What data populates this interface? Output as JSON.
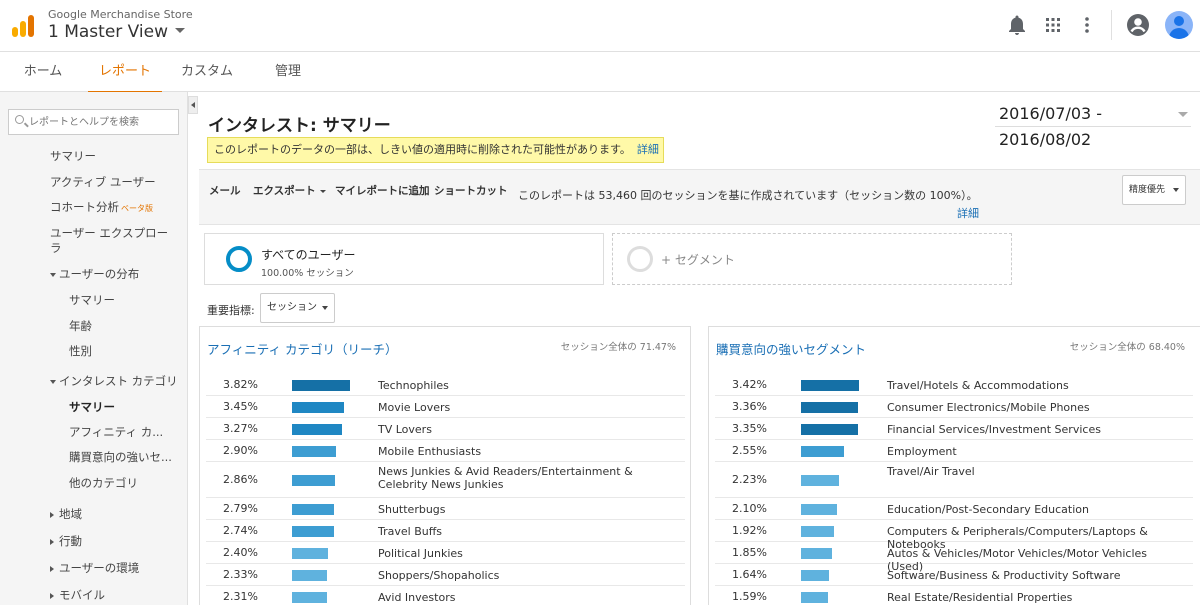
{
  "header": {
    "account": "Google Merchandise Store",
    "view": "1 Master View"
  },
  "nav": {
    "tabs": [
      "ホーム",
      "レポート",
      "カスタム",
      "管理"
    ],
    "active": "レポート"
  },
  "sidebar": {
    "search_placeholder": "レポートとヘルプを検索",
    "items": {
      "summary": "サマリー",
      "active_users": "アクティブ ユーザー",
      "cohort": "コホート分析",
      "cohort_beta": "ベータ版",
      "user_explorer": "ユーザー エクスプローラ",
      "demographics": "ユーザーの分布",
      "demo_summary": "サマリー",
      "age": "年齢",
      "gender": "性別",
      "interests": "インタレスト カテゴリ",
      "int_summary": "サマリー",
      "affinity": "アフィニティ カ...",
      "in_market": "購買意向の強いセ...",
      "other": "他のカテゴリ",
      "geo": "地域",
      "behavior": "行動",
      "technology": "ユーザーの環境",
      "mobile": "モバイル"
    }
  },
  "main": {
    "title": "インタレスト: サマリー",
    "date_range": "2016/07/03 - 2016/08/02",
    "warning": "このレポートのデータの一部は、しきい値の適用時に削除された可能性があります。",
    "warning_link": "詳細",
    "toolbar": {
      "email": "メール",
      "export": "エクスポート",
      "add_dashboard": "マイレポートに追加",
      "shortcut": "ショートカット"
    },
    "session_note": "このレポートは 53,460 回のセッションを基に作成されています（セッション数の 100%）。",
    "session_link": "詳細",
    "precision": "精度優先",
    "segment": {
      "name": "すべてのユーザー",
      "sub": "100.00% セッション",
      "add": "+ セグメント"
    },
    "metric_label": "重要指標:",
    "metric_value": "セッション"
  },
  "chart_data": [
    {
      "type": "bar",
      "title": "アフィニティ カテゴリ（リーチ）",
      "total": "セッション全体の 71.47%",
      "categories": [
        "Technophiles",
        "Movie Lovers",
        "TV Lovers",
        "Mobile Enthusiasts",
        "News Junkies & Avid Readers/Entertainment & Celebrity News Junkies",
        "Shutterbugs",
        "Travel Buffs",
        "Political Junkies",
        "Shoppers/Shopaholics",
        "Avid Investors"
      ],
      "values": [
        3.82,
        3.45,
        3.27,
        2.9,
        2.86,
        2.79,
        2.74,
        2.4,
        2.33,
        2.31
      ],
      "labels": [
        "3.82%",
        "3.45%",
        "3.27%",
        "2.90%",
        "2.86%",
        "2.79%",
        "2.74%",
        "2.40%",
        "2.33%",
        "2.31%"
      ]
    },
    {
      "type": "bar",
      "title": "購買意向の強いセグメント",
      "total": "セッション全体の 68.40%",
      "categories": [
        "Travel/Hotels & Accommodations",
        "Consumer Electronics/Mobile Phones",
        "Financial Services/Investment Services",
        "Employment",
        "Travel/Air Travel",
        "Education/Post-Secondary Education",
        "Computers & Peripherals/Computers/Laptops & Notebooks",
        "Autos & Vehicles/Motor Vehicles/Motor Vehicles (Used)",
        "Software/Business & Productivity Software",
        "Real Estate/Residential Properties"
      ],
      "values": [
        3.42,
        3.36,
        3.35,
        2.55,
        2.23,
        2.1,
        1.92,
        1.85,
        1.64,
        1.59
      ],
      "labels": [
        "3.42%",
        "3.36%",
        "3.35%",
        "2.55%",
        "2.23%",
        "2.10%",
        "1.92%",
        "1.85%",
        "1.64%",
        "1.59%"
      ]
    }
  ]
}
